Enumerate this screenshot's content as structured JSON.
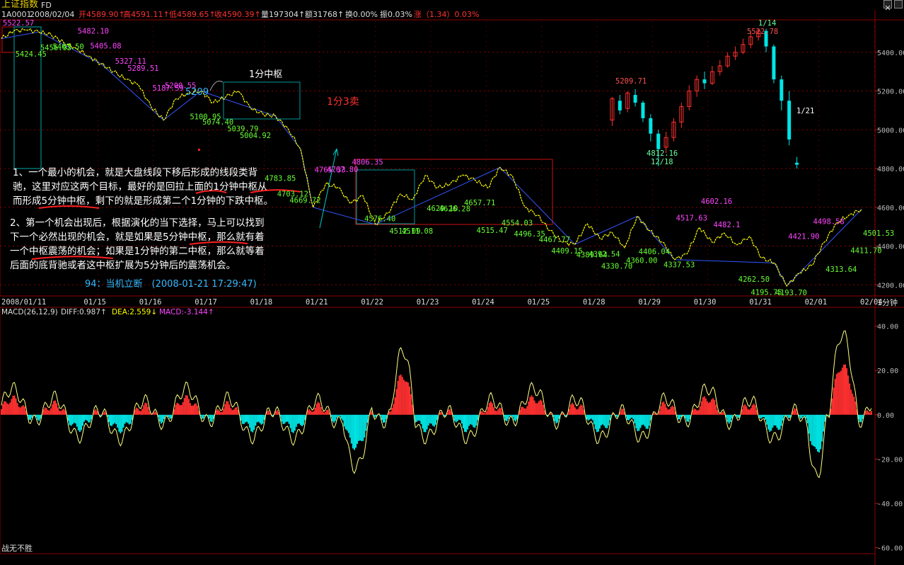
{
  "window": {
    "title": "上证指数",
    "flag": "FD",
    "close_icon": "close-icon"
  },
  "header": {
    "code": "1A0001",
    "date": "2008/02/04",
    "open": "开4589.90↑",
    "high": "高4591.11↑",
    "low": "低4589.65↑",
    "close": "收4590.39↑",
    "volume": "量197304↑",
    "amount": "额31768↑",
    "turnover": "换0.00%",
    "amplitude": "振0.03%",
    "change": "涨（1.34）0.03%"
  },
  "colors": {
    "up": "#ff3030",
    "down": "#00e5e5",
    "price_line": "#ffff00",
    "trend_line": "#3355ff",
    "low_label": "#66ff33",
    "high_label": "#ff44ff",
    "box_red": "#cc1010",
    "box_cyan": "#009999",
    "grid": "#8b0000"
  },
  "annotations": {
    "zhongshu_label": "1分中枢",
    "sell_label": "1分3卖",
    "level_5209": "5209",
    "note1_line1": "1、一个最小的机会，就是大盘线段下移后形成的线段类背",
    "note1_line2": "驰，这里对应这两个目标，最好的是回拉上面的1分钟中枢从",
    "note1_line3": "而形成5分钟中枢，剩下的就是形成第二个1分钟的下跌中枢。",
    "note2_line1": "2、第一个机会出现后，根据演化的当下选择，马上可以找到",
    "note2_line2": "下一个必然出现的机会，就是如果是5分钟中枢，那么就有着",
    "note2_line3": "一个中枢震荡的机会；如果是1分钟的第二中枢，那么就等着",
    "note2_line4": "后面的底背驰或者这中枢扩展为5分钟后的震荡机会。",
    "signature": "94：当机立断　(2008-01-21 17:29:47)",
    "footer": "战无不胜"
  },
  "price_labels": [
    "5522.57",
    "5424.45",
    "5456.93",
    "5463.50",
    "5482.10",
    "5405.08",
    "5327.11",
    "5289.51",
    "5187.59",
    "5200.55",
    "5100.95",
    "5074.40",
    "5039.79",
    "5004.92",
    "4783.85",
    "4703.12",
    "4669.72",
    "4765.33",
    "4767.80",
    "4806.35",
    "4576.40",
    "4512.09",
    "4511.08",
    "4629.10",
    "4626.28",
    "4657.71",
    "4515.47",
    "4554.03",
    "4496.35",
    "4467.77",
    "4409.15",
    "4389.64",
    "4392.54",
    "4330.70",
    "4360.00",
    "4406.04",
    "4337.53",
    "4517.63",
    "4602.16",
    "4482.1",
    "4262.50",
    "4195.75",
    "4193.70",
    "4421.90",
    "4498.58",
    "4313.64",
    "4411.70",
    "4501.53"
  ],
  "kline_inset": {
    "high_label": "5522.78",
    "high_date": "1/14",
    "mid_label": "5209.71",
    "low_label": "4812.16",
    "low_date": "12/18",
    "end_date": "1/21"
  },
  "chart_data": [
    {
      "type": "line",
      "title": "上证指数 1分钟",
      "period_label": "1分钟",
      "x_tick_labels": [
        "2008/01/11",
        "01/15",
        "01/16",
        "01/17",
        "01/18",
        "01/21",
        "01/22",
        "01/23",
        "01/24",
        "01/25",
        "01/28",
        "01/29",
        "01/30",
        "01/31",
        "02/01",
        "02/04"
      ],
      "y_tick_labels": [
        "5400.00",
        "5200.00",
        "5000.00",
        "4800.00",
        "4600.00",
        "4400.00",
        "4200.00"
      ],
      "ylim": [
        4150,
        5560
      ],
      "grid": true,
      "series": [
        {
          "values": [
            5470,
            5510,
            5515,
            5505,
            5490,
            5450,
            5420,
            5380,
            5340,
            5300,
            5260,
            5230,
            5120,
            5050,
            5160,
            5190,
            5200,
            5140,
            5170,
            5200,
            5110,
            5080,
            5070,
            5004,
            4900,
            4600,
            4720,
            4703,
            4620,
            4660,
            4512,
            4570,
            4669,
            4640,
            4765,
            4700,
            4720,
            4767,
            4740,
            4700,
            4806,
            4760,
            4600,
            4560,
            4480,
            4420,
            4409,
            4515,
            4440,
            4470,
            4392,
            4554,
            4480,
            4421,
            4330,
            4360,
            4496,
            4420,
            4467,
            4406,
            4450,
            4338,
            4313,
            4194,
            4260,
            4300,
            4420,
            4520,
            4560,
            4590
          ],
          "low_markers": [
            5424.45,
            5039.79,
            4512.09,
            4409.15,
            4330.7,
            4193.7
          ],
          "high_markers": [
            5522.57,
            5200.55,
            4806.35,
            4554.03,
            4602.16
          ]
        }
      ]
    },
    {
      "type": "bar",
      "title": "MACD(26,12,9)",
      "indicators": {
        "diff_label": "DIFF:0.987↑",
        "dea_label": "DEA:2.559↓",
        "macd_label": "MACD:-3.144↑"
      },
      "y_tick_labels": [
        "40.00",
        "20.00",
        "0.00",
        "-20.00",
        "-40.00",
        "-60.00"
      ],
      "ylim": [
        -62,
        44
      ],
      "grid": false
    }
  ]
}
